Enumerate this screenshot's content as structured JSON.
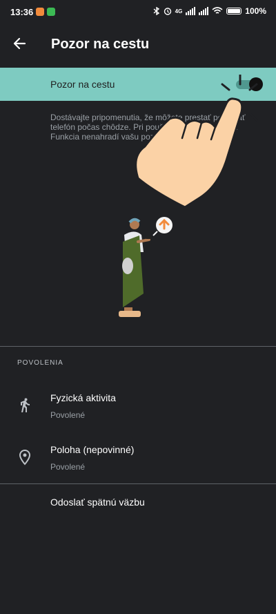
{
  "status_bar": {
    "time": "13:36",
    "network": "4G",
    "battery": "100"
  },
  "app_bar": {
    "title": "Pozor na cestu"
  },
  "toggle": {
    "label": "Pozor na cestu",
    "enabled": true
  },
  "description": "Dostávajte pripomenutia, že môžete prestať používať telefón počas chôdze. Pri používaní telefónu pozor. Funkcia nenahradí vašu pozornosť.",
  "permissions": {
    "header": "POVOLENIA",
    "items": [
      {
        "title": "Fyzická aktivita",
        "status": "Povolené",
        "icon": "walking-icon"
      },
      {
        "title": "Poloha (nepovinné)",
        "status": "Povolené",
        "icon": "location-pin-icon"
      }
    ]
  },
  "feedback": {
    "label": "Odoslať spätnú väzbu"
  },
  "colors": {
    "background": "#202124",
    "toggle_row": "#7ecbc1",
    "text_secondary": "#9aa0a6"
  }
}
